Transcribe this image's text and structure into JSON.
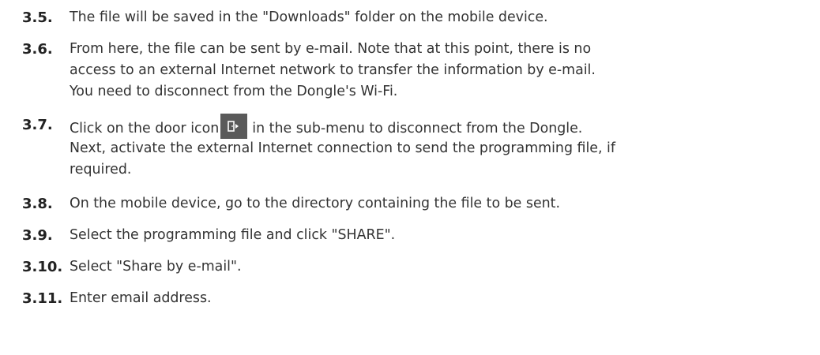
{
  "steps": [
    {
      "num": "3.5.",
      "lines": [
        "The file will be saved in the \"Downloads\" folder on the mobile device."
      ]
    },
    {
      "num": "3.6.",
      "lines": [
        "From here, the file can be sent by e-mail. Note that at this point, there is no",
        "access to an external Internet network to transfer the information by e-mail.",
        "You need to disconnect from the Dongle's Wi-Fi."
      ]
    },
    {
      "num": "3.7.",
      "line1_before_icon": "Click on the door icon",
      "line1_after_icon": "in the sub-menu to disconnect from the Dongle.",
      "icon": "door-exit-icon",
      "lines_after": [
        "Next, activate the external Internet connection to send the programming file, if",
        "required."
      ]
    },
    {
      "num": "3.8.",
      "lines": [
        "On the mobile device, go to the directory containing the file to be sent."
      ]
    },
    {
      "num": "3.9.",
      "lines": [
        "Select the programming file and click \"SHARE\"."
      ]
    },
    {
      "num": "3.10.",
      "lines": [
        "Select \"Share by e-mail\"."
      ]
    },
    {
      "num": "3.11.",
      "lines": [
        "Enter email address."
      ]
    }
  ],
  "colors": {
    "text": "#333333",
    "number": "#222222",
    "icon_background": "#5a5a5a"
  }
}
